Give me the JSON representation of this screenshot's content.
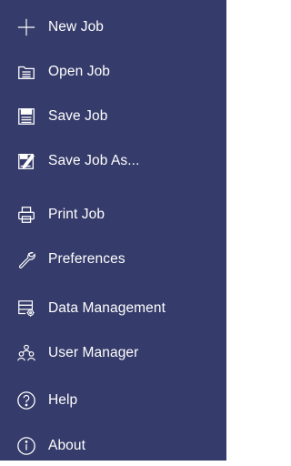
{
  "menu": {
    "items": [
      {
        "label": "New Job",
        "icon": "plus-icon"
      },
      {
        "label": "Open Job",
        "icon": "folder-open-icon"
      },
      {
        "label": "Save Job",
        "icon": "save-icon"
      },
      {
        "label": "Save Job As...",
        "icon": "save-as-icon"
      },
      {
        "label": "Print Job",
        "icon": "printer-icon"
      },
      {
        "label": "Preferences",
        "icon": "wrench-icon"
      },
      {
        "label": "Data Management",
        "icon": "data-settings-icon"
      },
      {
        "label": "User Manager",
        "icon": "users-icon"
      },
      {
        "label": "Help",
        "icon": "help-icon"
      },
      {
        "label": "About",
        "icon": "info-icon"
      }
    ]
  },
  "colors": {
    "background": "#353b6a",
    "text": "#ffffff"
  }
}
